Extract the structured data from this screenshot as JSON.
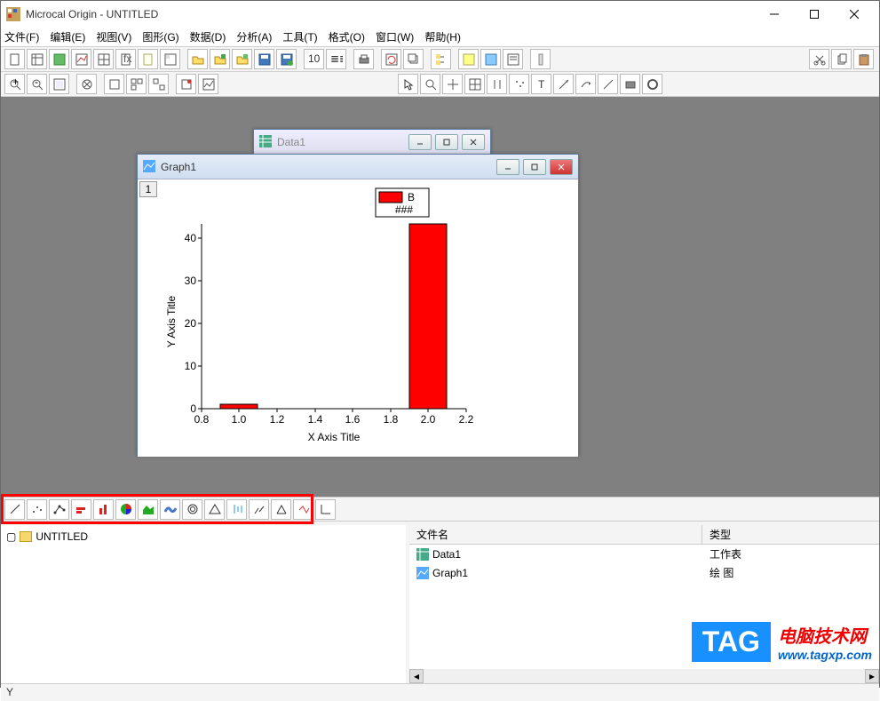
{
  "window": {
    "title": "Microcal Origin - UNTITLED"
  },
  "menu": {
    "file": "文件(F)",
    "edit": "编辑(E)",
    "view": "视图(V)",
    "graph": "图形(G)",
    "data": "数据(D)",
    "analysis": "分析(A)",
    "tools": "工具(T)",
    "format": "格式(O)",
    "window": "窗口(W)",
    "help": "帮助(H)"
  },
  "mdi": {
    "data1": {
      "title": "Data1"
    },
    "graph1": {
      "title": "Graph1"
    }
  },
  "chart": {
    "layer_tab": "1",
    "legend_series": "B",
    "legend_sub": "###",
    "ylabel": "Y Axis Title",
    "xlabel": "X Axis Title",
    "yticks": [
      "0",
      "10",
      "20",
      "30",
      "40"
    ],
    "xticks": [
      "0.8",
      "1.0",
      "1.2",
      "1.4",
      "1.6",
      "1.8",
      "2.0",
      "2.2"
    ]
  },
  "chart_data": {
    "type": "bar",
    "title": "",
    "xlabel": "X Axis Title",
    "ylabel": "Y Axis Title",
    "series": [
      {
        "name": "B",
        "color": "#ff0000",
        "x": [
          1.0,
          2.0
        ],
        "values": [
          1,
          42
        ]
      }
    ],
    "ylim": [
      0,
      45
    ],
    "xlim": [
      0.8,
      2.2
    ],
    "yticks": [
      0,
      10,
      20,
      30,
      40
    ],
    "xticks": [
      0.8,
      1.0,
      1.2,
      1.4,
      1.6,
      1.8,
      2.0,
      2.2
    ]
  },
  "explorer": {
    "root": "UNTITLED",
    "columns": {
      "name": "文件名",
      "type": "类型"
    },
    "items": [
      {
        "name": "Data1",
        "type": "工作表",
        "icon": "worksheet"
      },
      {
        "name": "Graph1",
        "type": "绘 图",
        "icon": "graph"
      }
    ]
  },
  "statusbar": {
    "text": "Y"
  },
  "watermark": {
    "badge": "TAG",
    "line1": "电脑技术网",
    "line2": "www.tagxp.com"
  }
}
